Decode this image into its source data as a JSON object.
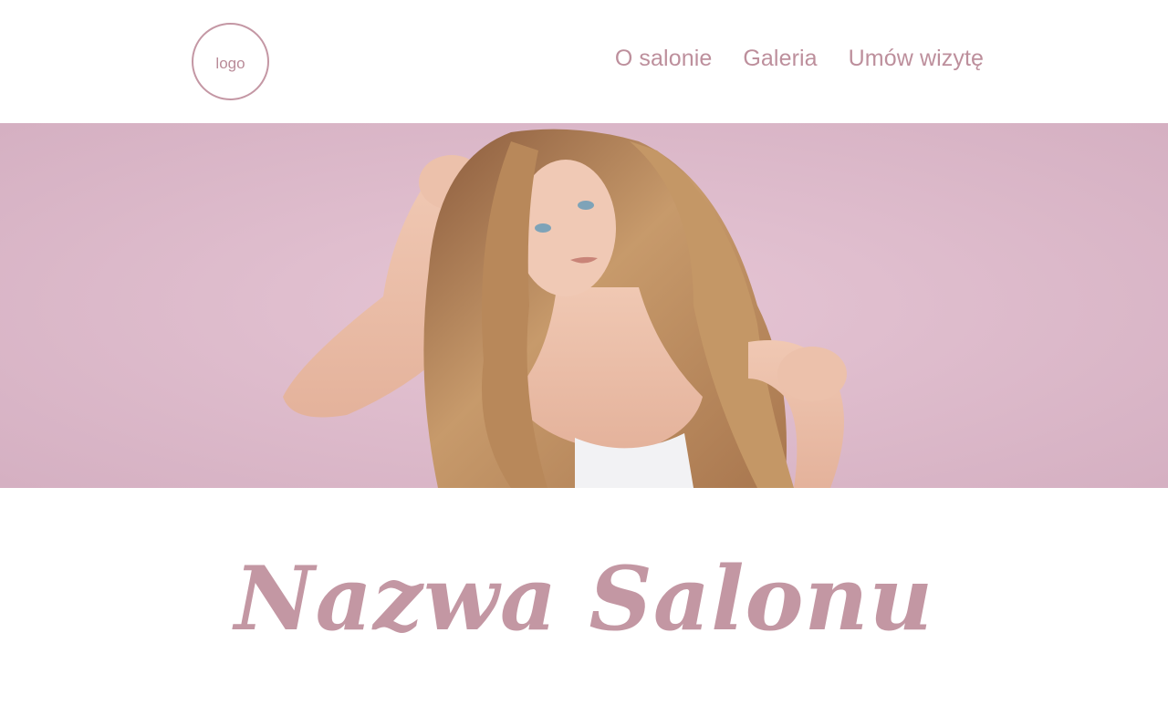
{
  "header": {
    "logo_text": "logo",
    "nav": {
      "about": "O salonie",
      "gallery": "Galeria",
      "booking": "Umów wizytę"
    }
  },
  "hero": {
    "background_color": "#dcbac8"
  },
  "main": {
    "title": "Nazwa Salonu"
  },
  "colors": {
    "accent": "#c497a4"
  }
}
